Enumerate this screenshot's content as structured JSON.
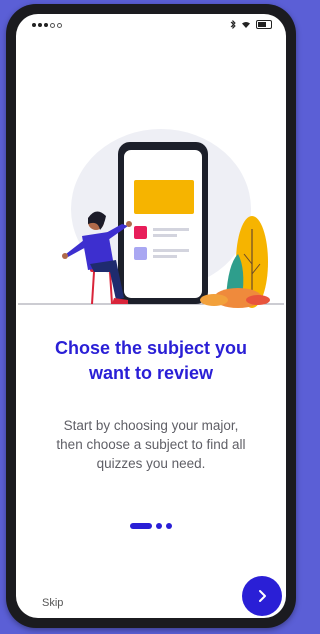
{
  "onboarding": {
    "title_line1": "Chose the subject you",
    "title_line2": "want to review",
    "description_lines": [
      "Start by choosing your major,",
      "then choose a subject to find all",
      "quizzes you need."
    ],
    "skip_label": "Skip",
    "next_icon": "chevron-right-icon",
    "page_indicator": {
      "total_pages": 3,
      "current_page": 1
    }
  },
  "colors": {
    "accent": "#2a1fd6",
    "background": "#5b5fd6",
    "frame": "#1b1b1f",
    "text_muted": "#5f5f66"
  },
  "status_bar": {
    "icons": [
      "signal-icon",
      "bluetooth-icon",
      "wifi-icon",
      "battery-icon"
    ]
  },
  "illustration": {
    "subject": "woman-pointing-at-phone-illustration"
  }
}
